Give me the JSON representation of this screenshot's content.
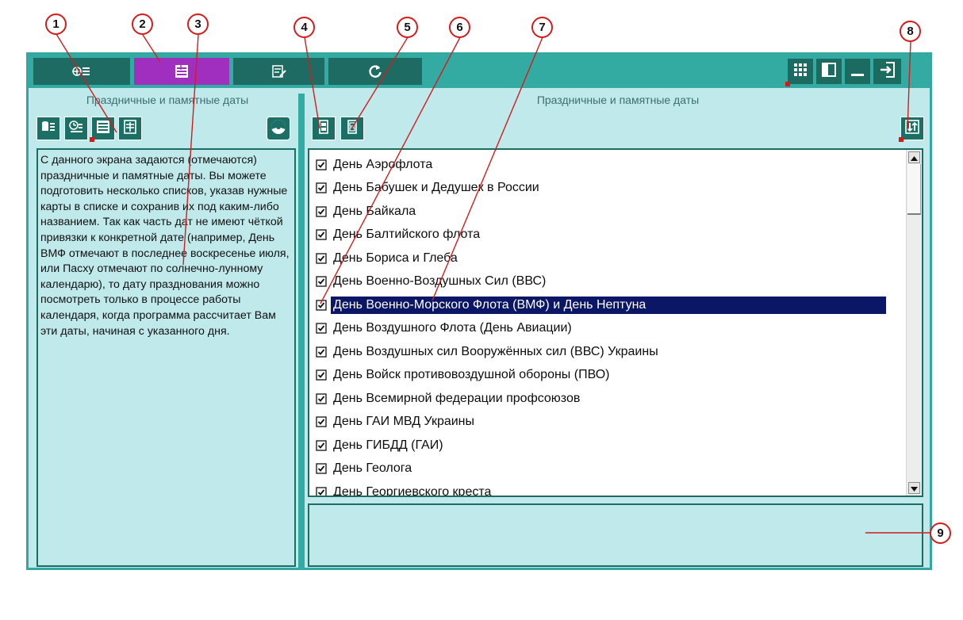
{
  "tabs": [
    {
      "icon": "map-list-icon",
      "active": false
    },
    {
      "icon": "list-view-icon",
      "active": true
    },
    {
      "icon": "calendar-edit-icon",
      "active": false
    },
    {
      "icon": "refresh-icon",
      "active": false
    }
  ],
  "window_controls": [
    "grid-icon",
    "panel-toggle-icon",
    "minimize-icon",
    "exit-icon"
  ],
  "left_panel": {
    "title": "Праздничные и памятные даты",
    "toolbar": [
      "list-database-icon",
      "list-clock-icon",
      "list-view-icon",
      "list-edit-icon"
    ],
    "pie_icon": "pie-chart-icon",
    "description": "С данного экрана задаются (отмечаются) праздничные и памятные даты. Вы можете подготовить несколько списков, указав нужные карты в списке и сохранив их под каким-либо названием. Так как часть дат не имеют чёткой привязки к конкретной дате (например, День ВМФ отмечают в последнее воскресенье июля, или Пасху отмечают по солнечно-лунному календарю), то дату празднования можно посмотреть только в процессе работы календаря, когда программа рассчитает Вам эти даты, начиная с указанного дня."
  },
  "right_panel": {
    "title": "Праздничные и памятные даты",
    "toolbar": [
      "select-all-icon",
      "deselect-all-icon"
    ],
    "sort_icon": "sort-icon",
    "items": [
      {
        "label": "День Аэрофлота",
        "checked": true,
        "selected": false
      },
      {
        "label": "День Бабушек и Дедушек в России",
        "checked": true,
        "selected": false
      },
      {
        "label": "День Байкала",
        "checked": true,
        "selected": false
      },
      {
        "label": "День Балтийского флота",
        "checked": true,
        "selected": false
      },
      {
        "label": "День Бориса и Глеба",
        "checked": true,
        "selected": false
      },
      {
        "label": "День Военно-Воздушных Сил (ВВС)",
        "checked": true,
        "selected": false
      },
      {
        "label": "День Военно-Морского Флота (ВМФ) и День Нептуна",
        "checked": true,
        "selected": true
      },
      {
        "label": "День Воздушного Флота (День Авиации)",
        "checked": true,
        "selected": false
      },
      {
        "label": "День Воздушных сил Вооружённых сил (ВВС) Украины",
        "checked": true,
        "selected": false
      },
      {
        "label": "День Войск противовоздушной обороны (ПВО)",
        "checked": true,
        "selected": false
      },
      {
        "label": "День Всемирной федерации профсоюзов",
        "checked": true,
        "selected": false
      },
      {
        "label": "День ГАИ МВД Украины",
        "checked": true,
        "selected": false
      },
      {
        "label": "День ГИБДД (ГАИ)",
        "checked": true,
        "selected": false
      },
      {
        "label": "День Геолога",
        "checked": true,
        "selected": false
      },
      {
        "label": "День Георгиевского креста",
        "checked": true,
        "selected": false
      }
    ],
    "detail_text": ""
  },
  "callouts": [
    "1",
    "2",
    "3",
    "4",
    "5",
    "6",
    "7",
    "8",
    "9"
  ],
  "colors": {
    "window_bg": "#bfe9ea",
    "frame": "#34a7a0",
    "button_dark": "#1b6f64",
    "active_tab": "#a02fbf",
    "selection": "#0b1667",
    "callout": "#d41c1c"
  }
}
